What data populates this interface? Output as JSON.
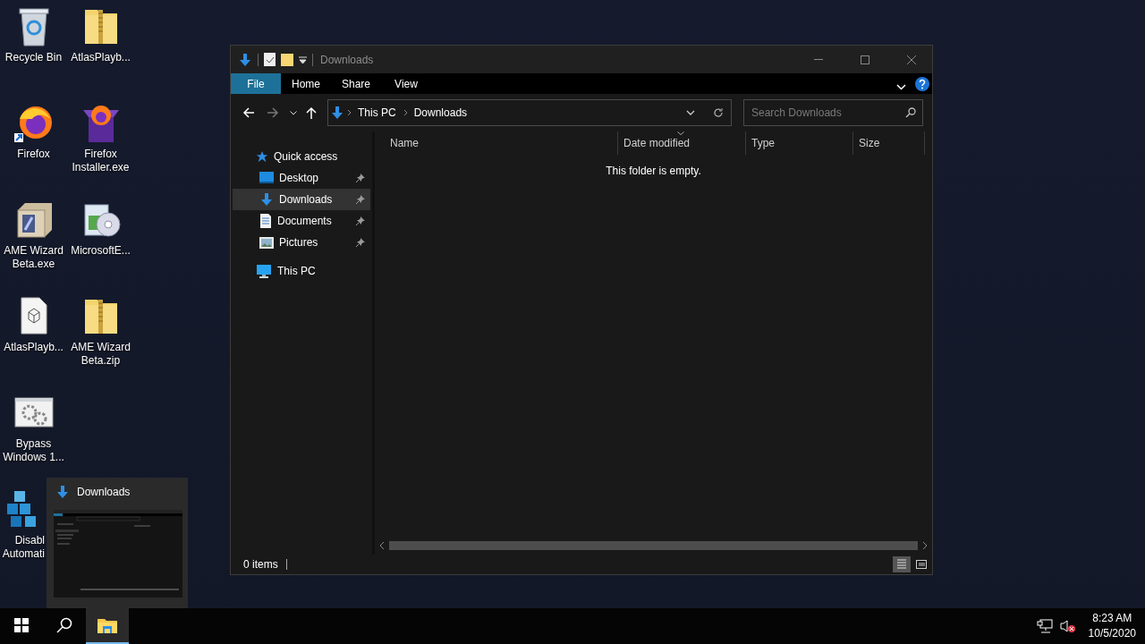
{
  "desktop_icons": [
    {
      "label": "Recycle Bin",
      "kind": "recycle",
      "covered": false
    },
    {
      "label": "Firefox",
      "kind": "firefox",
      "covered": false
    },
    {
      "label": "AME Wizard Beta.exe",
      "kind": "box",
      "covered": false
    },
    {
      "label": "AtlasPlayb...",
      "kind": "file",
      "covered": false
    },
    {
      "label": "Bypass Windows 1...",
      "kind": "settings",
      "covered": false
    },
    {
      "label": "Disabl Automati",
      "kind": "cubes",
      "covered": true
    },
    {
      "label": "AtlasPlayb...",
      "kind": "zip",
      "covered": false
    },
    {
      "label": "Firefox Installer.exe",
      "kind": "installer",
      "covered": false
    },
    {
      "label": "MicrosoftE...",
      "kind": "setup",
      "covered": false
    },
    {
      "label": "AME Wizard Beta.zip",
      "kind": "zip",
      "covered": false
    }
  ],
  "taskbar_preview": {
    "title": "Downloads"
  },
  "explorer": {
    "title": "Downloads",
    "ribbon_tabs": [
      {
        "label": "File",
        "selected": true
      },
      {
        "label": "Home",
        "selected": false
      },
      {
        "label": "Share",
        "selected": false
      },
      {
        "label": "View",
        "selected": false
      }
    ],
    "address": [
      "This PC",
      "Downloads"
    ],
    "search": {
      "placeholder": "Search Downloads"
    },
    "nav": [
      {
        "label": "Quick access",
        "kind": "star",
        "selected": false,
        "children": [
          {
            "label": "Desktop",
            "kind": "desktop",
            "selected": false,
            "pinned": true
          },
          {
            "label": "Downloads",
            "kind": "download",
            "selected": true,
            "pinned": true
          },
          {
            "label": "Documents",
            "kind": "document",
            "selected": false,
            "pinned": true
          },
          {
            "label": "Pictures",
            "kind": "pictures",
            "selected": false,
            "pinned": true
          }
        ]
      },
      {
        "label": "This PC",
        "kind": "pc",
        "selected": false
      }
    ],
    "columns": [
      {
        "label": "Name",
        "sorted": false
      },
      {
        "label": "Date modified",
        "sorted": true
      },
      {
        "label": "Type",
        "sorted": false
      },
      {
        "label": "Size",
        "sorted": false
      }
    ],
    "empty_message": "This folder is empty.",
    "status": "0 items",
    "views": [
      {
        "kind": "details",
        "selected": true
      },
      {
        "kind": "tiles",
        "selected": false
      }
    ]
  },
  "taskbar": {
    "apps": [
      {
        "kind": "start",
        "active": false
      },
      {
        "kind": "search",
        "active": false
      },
      {
        "kind": "explorer",
        "active": true
      }
    ],
    "volume_muted": true,
    "clock": {
      "time": "8:23 AM",
      "date": "10/5/2020"
    }
  }
}
